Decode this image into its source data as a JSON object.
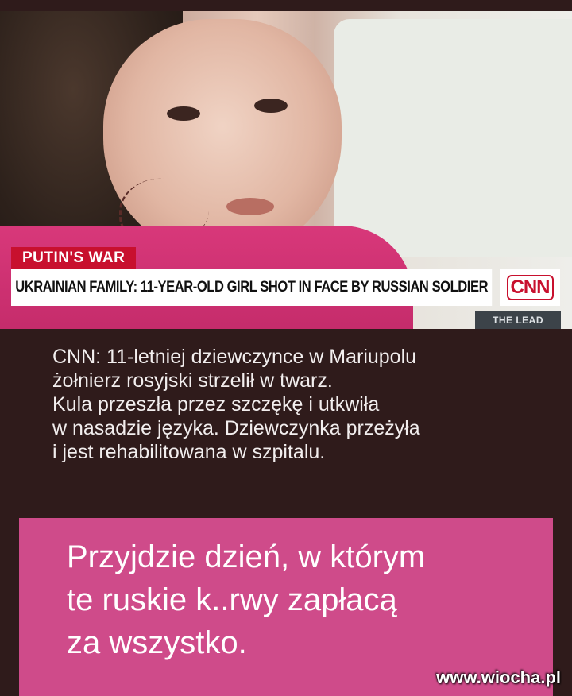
{
  "news_frame": {
    "program_tag": "PUTIN'S WAR",
    "headline": "UKRAINIAN FAMILY: 11-YEAR-OLD GIRL SHOT IN FACE BY RUSSIAN SOLDIER",
    "network_logo": "CNN",
    "show_name": "THE LEAD"
  },
  "caption": {
    "lines": [
      "CNN: 11-letniej dziewczynce w Mariupolu",
      "żołnierz rosyjski strzelił w twarz.",
      "Kula przeszła przez szczękę i utkwiła",
      "w nasadzie języka. Dziewczynka przeżyła",
      "i jest rehabilitowana w szpitalu."
    ]
  },
  "message": {
    "lines": [
      "Przyjdzie dzień, w którym",
      "te ruskie k..rwy zapłacą",
      "za wszystko."
    ]
  },
  "watermark": "www.wiocha.pl",
  "colors": {
    "background": "#2f1b1b",
    "pink_box": "#cf4b8a",
    "cnn_red": "#c8102e"
  }
}
